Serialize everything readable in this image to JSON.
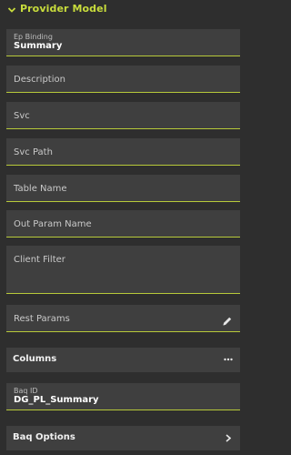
{
  "section": {
    "title": "Provider Model",
    "icon": "chevron-down-icon"
  },
  "fields": {
    "ep_binding": {
      "label": "Ep Binding",
      "value": "Summary"
    },
    "description": {
      "placeholder": "Description"
    },
    "svc": {
      "placeholder": "Svc"
    },
    "svc_path": {
      "placeholder": "Svc Path"
    },
    "table_name": {
      "placeholder": "Table Name"
    },
    "out_param_name": {
      "placeholder": "Out Param Name"
    },
    "client_filter": {
      "placeholder": "Client Filter"
    },
    "rest_params": {
      "placeholder": "Rest Params",
      "icon": "pencil-icon"
    },
    "baq_id": {
      "label": "Baq ID",
      "value": "DG_PL_Summary"
    }
  },
  "buttons": {
    "columns": {
      "label": "Columns",
      "icon": "more-horizontal-icon"
    },
    "baq_options": {
      "label": "Baq Options",
      "icon": "chevron-right-icon"
    }
  },
  "colors": {
    "accent": "#c8dc3c",
    "field_bg": "#3f3f3f",
    "page_bg": "#2e2e2e"
  }
}
